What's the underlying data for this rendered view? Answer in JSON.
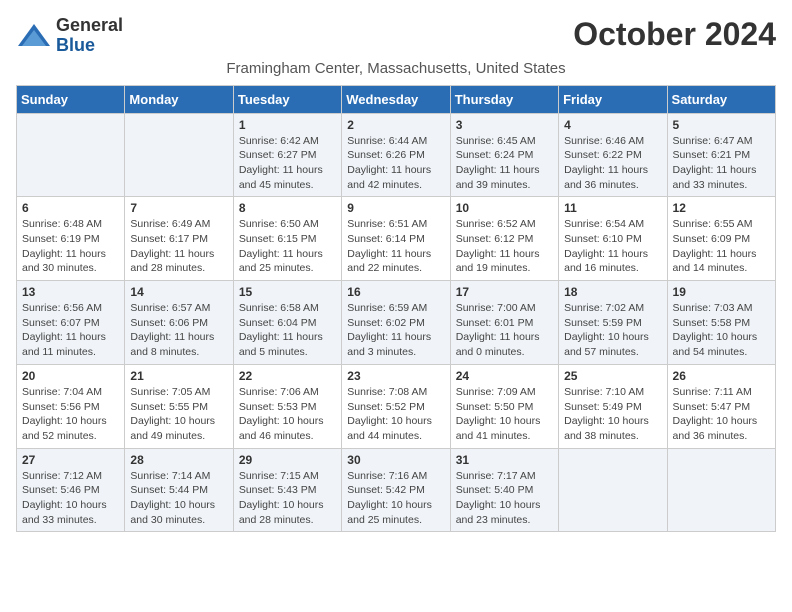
{
  "logo": {
    "general": "General",
    "blue": "Blue"
  },
  "header": {
    "month_title": "October 2024",
    "subtitle": "Framingham Center, Massachusetts, United States"
  },
  "days_of_week": [
    "Sunday",
    "Monday",
    "Tuesday",
    "Wednesday",
    "Thursday",
    "Friday",
    "Saturday"
  ],
  "weeks": [
    [
      {
        "day": "",
        "sunrise": "",
        "sunset": "",
        "daylight": ""
      },
      {
        "day": "",
        "sunrise": "",
        "sunset": "",
        "daylight": ""
      },
      {
        "day": "1",
        "sunrise": "Sunrise: 6:42 AM",
        "sunset": "Sunset: 6:27 PM",
        "daylight": "Daylight: 11 hours and 45 minutes."
      },
      {
        "day": "2",
        "sunrise": "Sunrise: 6:44 AM",
        "sunset": "Sunset: 6:26 PM",
        "daylight": "Daylight: 11 hours and 42 minutes."
      },
      {
        "day": "3",
        "sunrise": "Sunrise: 6:45 AM",
        "sunset": "Sunset: 6:24 PM",
        "daylight": "Daylight: 11 hours and 39 minutes."
      },
      {
        "day": "4",
        "sunrise": "Sunrise: 6:46 AM",
        "sunset": "Sunset: 6:22 PM",
        "daylight": "Daylight: 11 hours and 36 minutes."
      },
      {
        "day": "5",
        "sunrise": "Sunrise: 6:47 AM",
        "sunset": "Sunset: 6:21 PM",
        "daylight": "Daylight: 11 hours and 33 minutes."
      }
    ],
    [
      {
        "day": "6",
        "sunrise": "Sunrise: 6:48 AM",
        "sunset": "Sunset: 6:19 PM",
        "daylight": "Daylight: 11 hours and 30 minutes."
      },
      {
        "day": "7",
        "sunrise": "Sunrise: 6:49 AM",
        "sunset": "Sunset: 6:17 PM",
        "daylight": "Daylight: 11 hours and 28 minutes."
      },
      {
        "day": "8",
        "sunrise": "Sunrise: 6:50 AM",
        "sunset": "Sunset: 6:15 PM",
        "daylight": "Daylight: 11 hours and 25 minutes."
      },
      {
        "day": "9",
        "sunrise": "Sunrise: 6:51 AM",
        "sunset": "Sunset: 6:14 PM",
        "daylight": "Daylight: 11 hours and 22 minutes."
      },
      {
        "day": "10",
        "sunrise": "Sunrise: 6:52 AM",
        "sunset": "Sunset: 6:12 PM",
        "daylight": "Daylight: 11 hours and 19 minutes."
      },
      {
        "day": "11",
        "sunrise": "Sunrise: 6:54 AM",
        "sunset": "Sunset: 6:10 PM",
        "daylight": "Daylight: 11 hours and 16 minutes."
      },
      {
        "day": "12",
        "sunrise": "Sunrise: 6:55 AM",
        "sunset": "Sunset: 6:09 PM",
        "daylight": "Daylight: 11 hours and 14 minutes."
      }
    ],
    [
      {
        "day": "13",
        "sunrise": "Sunrise: 6:56 AM",
        "sunset": "Sunset: 6:07 PM",
        "daylight": "Daylight: 11 hours and 11 minutes."
      },
      {
        "day": "14",
        "sunrise": "Sunrise: 6:57 AM",
        "sunset": "Sunset: 6:06 PM",
        "daylight": "Daylight: 11 hours and 8 minutes."
      },
      {
        "day": "15",
        "sunrise": "Sunrise: 6:58 AM",
        "sunset": "Sunset: 6:04 PM",
        "daylight": "Daylight: 11 hours and 5 minutes."
      },
      {
        "day": "16",
        "sunrise": "Sunrise: 6:59 AM",
        "sunset": "Sunset: 6:02 PM",
        "daylight": "Daylight: 11 hours and 3 minutes."
      },
      {
        "day": "17",
        "sunrise": "Sunrise: 7:00 AM",
        "sunset": "Sunset: 6:01 PM",
        "daylight": "Daylight: 11 hours and 0 minutes."
      },
      {
        "day": "18",
        "sunrise": "Sunrise: 7:02 AM",
        "sunset": "Sunset: 5:59 PM",
        "daylight": "Daylight: 10 hours and 57 minutes."
      },
      {
        "day": "19",
        "sunrise": "Sunrise: 7:03 AM",
        "sunset": "Sunset: 5:58 PM",
        "daylight": "Daylight: 10 hours and 54 minutes."
      }
    ],
    [
      {
        "day": "20",
        "sunrise": "Sunrise: 7:04 AM",
        "sunset": "Sunset: 5:56 PM",
        "daylight": "Daylight: 10 hours and 52 minutes."
      },
      {
        "day": "21",
        "sunrise": "Sunrise: 7:05 AM",
        "sunset": "Sunset: 5:55 PM",
        "daylight": "Daylight: 10 hours and 49 minutes."
      },
      {
        "day": "22",
        "sunrise": "Sunrise: 7:06 AM",
        "sunset": "Sunset: 5:53 PM",
        "daylight": "Daylight: 10 hours and 46 minutes."
      },
      {
        "day": "23",
        "sunrise": "Sunrise: 7:08 AM",
        "sunset": "Sunset: 5:52 PM",
        "daylight": "Daylight: 10 hours and 44 minutes."
      },
      {
        "day": "24",
        "sunrise": "Sunrise: 7:09 AM",
        "sunset": "Sunset: 5:50 PM",
        "daylight": "Daylight: 10 hours and 41 minutes."
      },
      {
        "day": "25",
        "sunrise": "Sunrise: 7:10 AM",
        "sunset": "Sunset: 5:49 PM",
        "daylight": "Daylight: 10 hours and 38 minutes."
      },
      {
        "day": "26",
        "sunrise": "Sunrise: 7:11 AM",
        "sunset": "Sunset: 5:47 PM",
        "daylight": "Daylight: 10 hours and 36 minutes."
      }
    ],
    [
      {
        "day": "27",
        "sunrise": "Sunrise: 7:12 AM",
        "sunset": "Sunset: 5:46 PM",
        "daylight": "Daylight: 10 hours and 33 minutes."
      },
      {
        "day": "28",
        "sunrise": "Sunrise: 7:14 AM",
        "sunset": "Sunset: 5:44 PM",
        "daylight": "Daylight: 10 hours and 30 minutes."
      },
      {
        "day": "29",
        "sunrise": "Sunrise: 7:15 AM",
        "sunset": "Sunset: 5:43 PM",
        "daylight": "Daylight: 10 hours and 28 minutes."
      },
      {
        "day": "30",
        "sunrise": "Sunrise: 7:16 AM",
        "sunset": "Sunset: 5:42 PM",
        "daylight": "Daylight: 10 hours and 25 minutes."
      },
      {
        "day": "31",
        "sunrise": "Sunrise: 7:17 AM",
        "sunset": "Sunset: 5:40 PM",
        "daylight": "Daylight: 10 hours and 23 minutes."
      },
      {
        "day": "",
        "sunrise": "",
        "sunset": "",
        "daylight": ""
      },
      {
        "day": "",
        "sunrise": "",
        "sunset": "",
        "daylight": ""
      }
    ]
  ]
}
